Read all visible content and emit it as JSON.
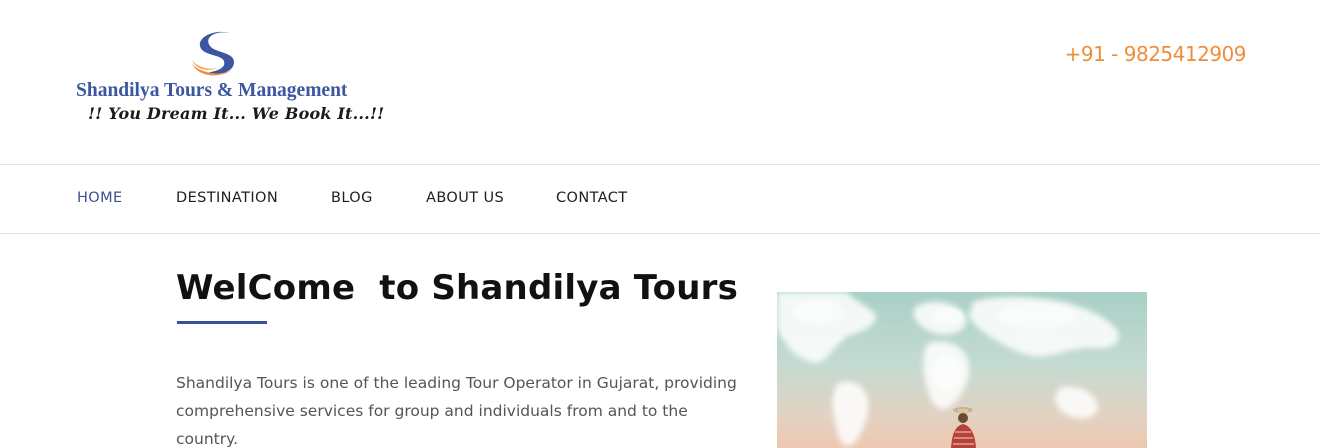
{
  "header": {
    "logo": {
      "name": "Shandilya Tours & Management",
      "tagline": "!! You Dream It... We Book It...!!"
    },
    "phone": "+91 - 9825412909"
  },
  "nav": {
    "items": [
      {
        "label": "HOME",
        "active": true
      },
      {
        "label": "DESTINATION",
        "active": false
      },
      {
        "label": "BLOG",
        "active": false
      },
      {
        "label": "ABOUT US",
        "active": false
      },
      {
        "label": "CONTACT",
        "active": false
      }
    ]
  },
  "main": {
    "title": "WelCome  to Shandilya Tours",
    "intro": "Shandilya Tours is one of the leading Tour Operator in Gujarat, providing comprehensive services for group and individuals from and to the country."
  },
  "colors": {
    "brand_blue": "#3b56a3",
    "accent_orange": "#ee8e3a",
    "nav_active": "#3d4f91",
    "underline": "#3b4f9a"
  },
  "icons": {
    "logo_mark": "s-swoosh-logo-icon"
  }
}
